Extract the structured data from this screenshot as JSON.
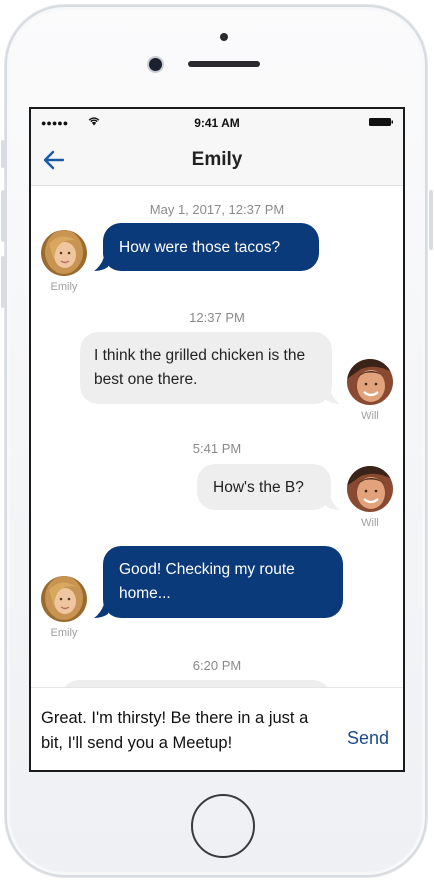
{
  "status_bar": {
    "signal": "●●●●●",
    "time": "9:41 AM"
  },
  "header": {
    "title": "Emily",
    "back_icon": "back-arrow-icon"
  },
  "messages": [
    {
      "timestamp": "May 1, 2017, 12:37 PM",
      "sender": "Emily",
      "text": "How were those tacos?",
      "side": "left"
    },
    {
      "timestamp": "12:37 PM",
      "sender": "Will",
      "text": "I think the grilled chicken is the best one there.",
      "side": "right"
    },
    {
      "timestamp": "5:41 PM",
      "sender": "Will",
      "text": "How's the B?",
      "side": "right"
    },
    {
      "timestamp": "",
      "sender": "Emily",
      "text": "Good! Checking my route home...",
      "side": "left"
    },
    {
      "timestamp": "6:20 PM",
      "sender": "",
      "text": "",
      "side": "right"
    }
  ],
  "composer": {
    "value": "Great. I'm thirsty! Be there in a just a bit, I'll send you a Meetup!",
    "send_label": "Send"
  },
  "colors": {
    "sent_bubble": "#0b3a7a",
    "received_bubble": "#eeeeee",
    "accent": "#1a4a8a"
  }
}
